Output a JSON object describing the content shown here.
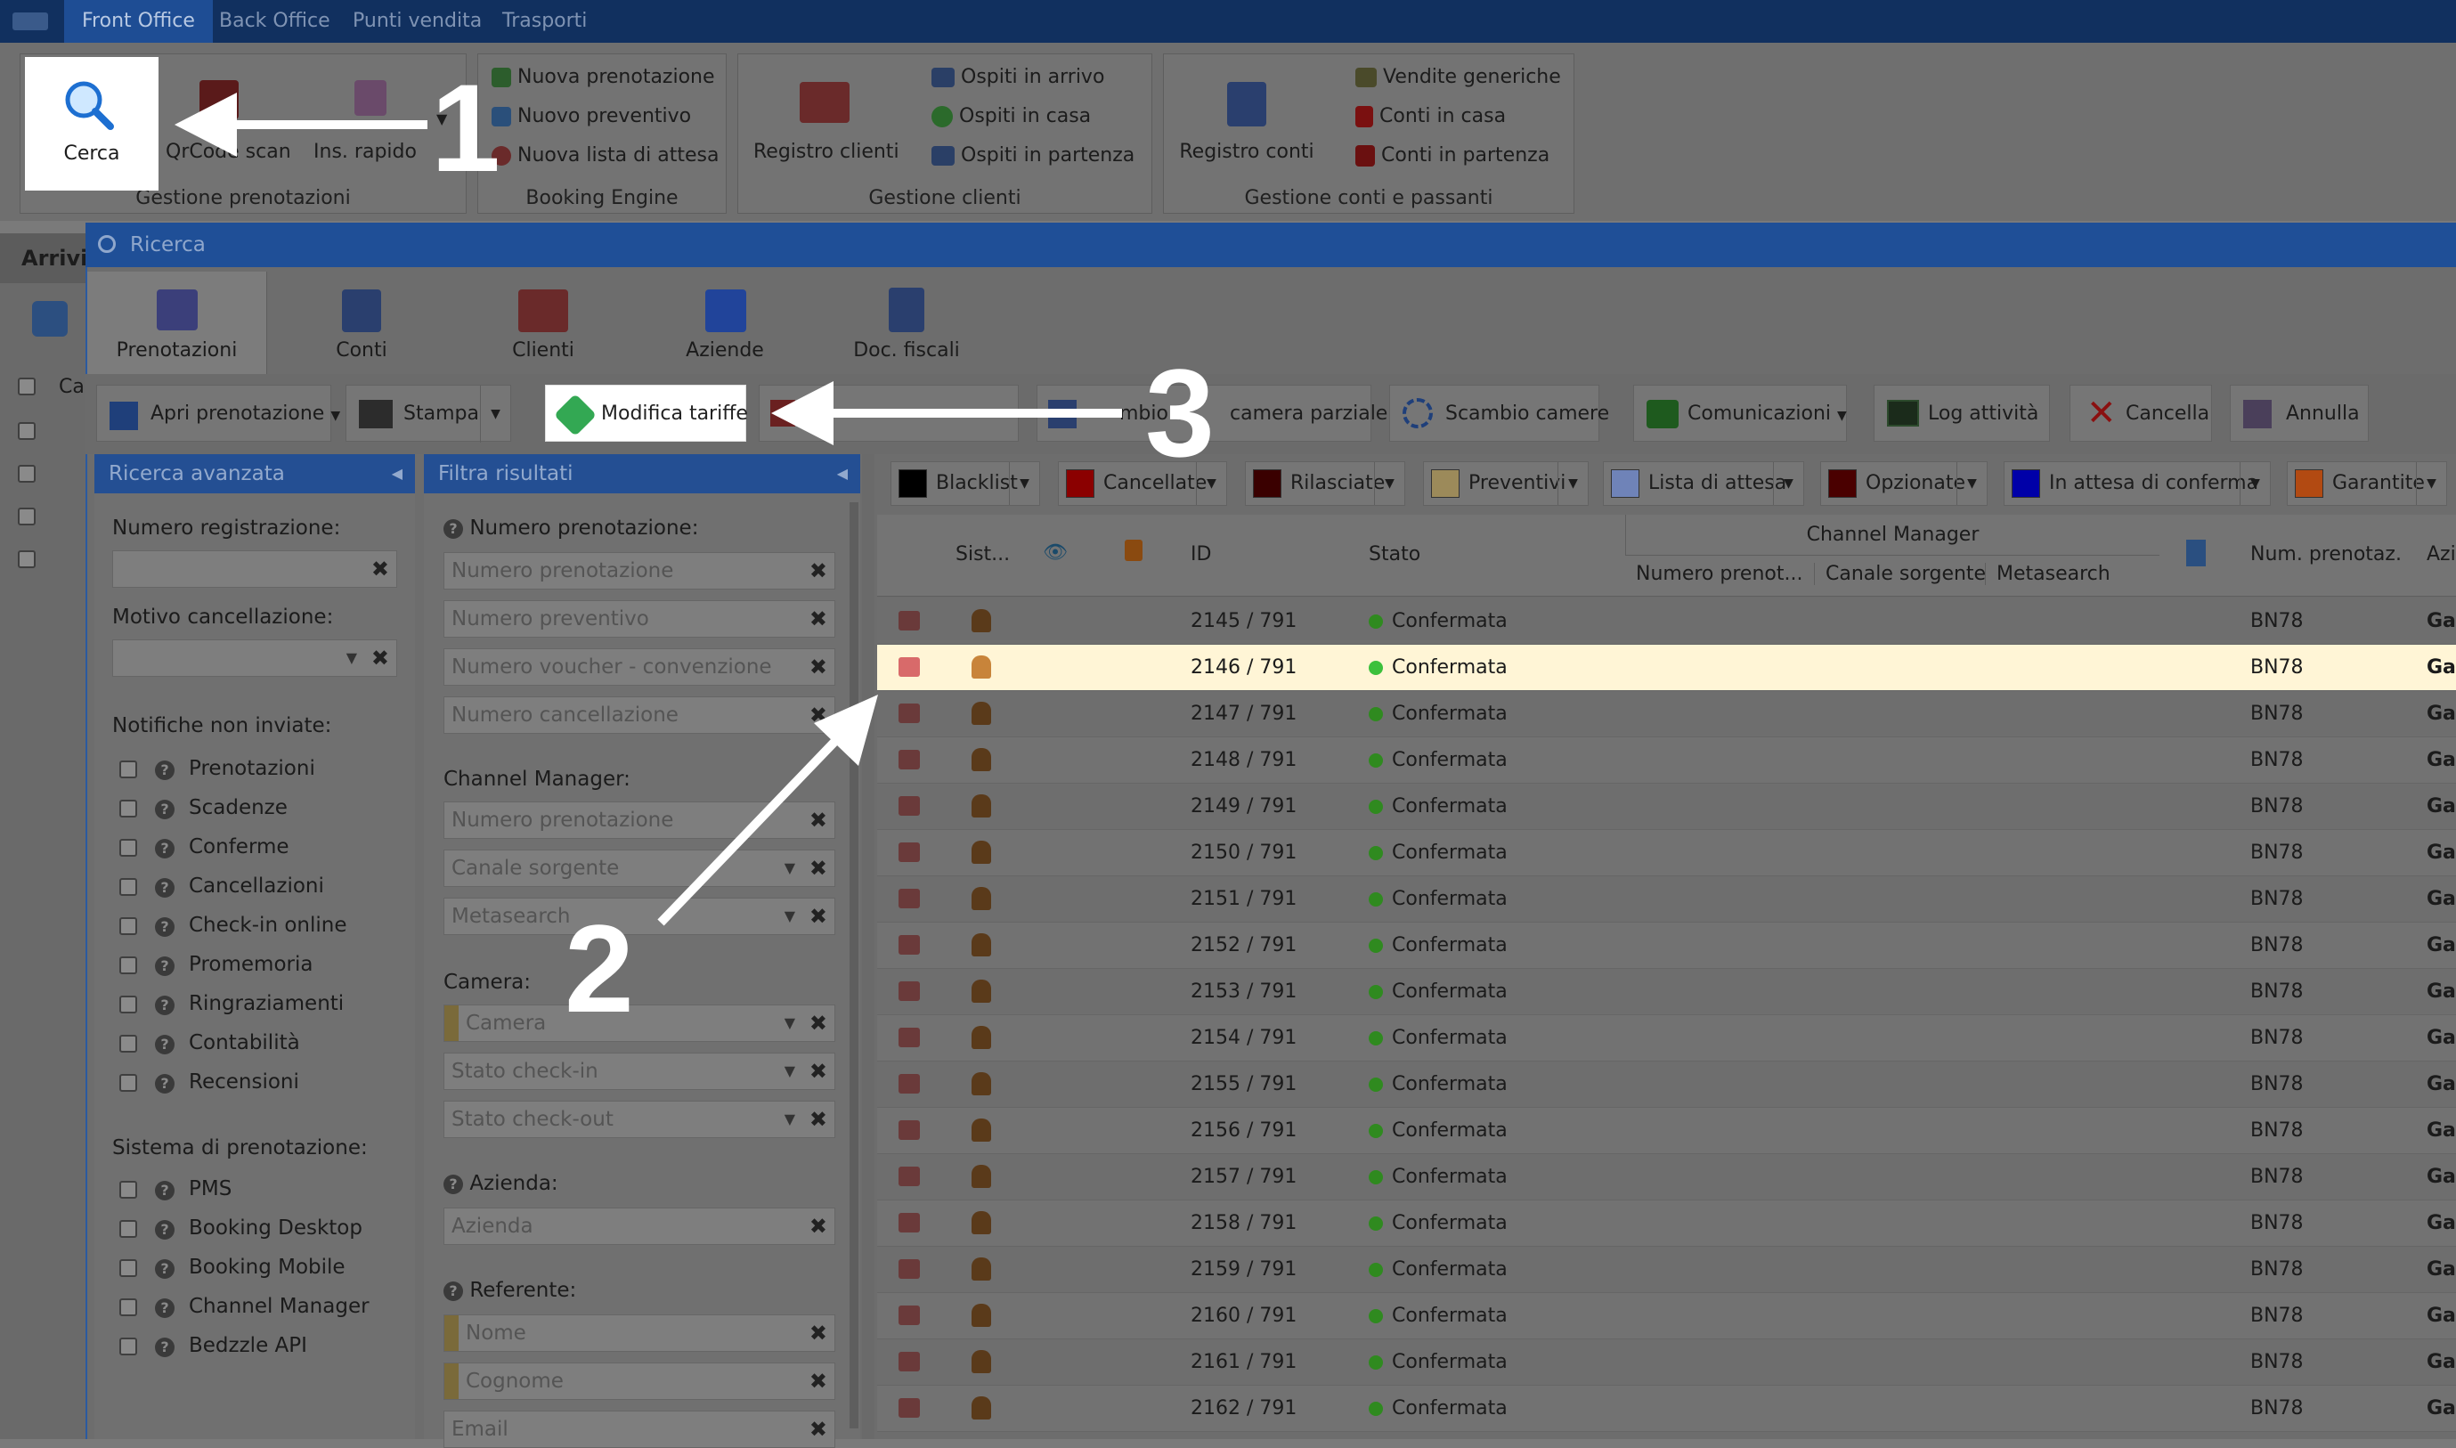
{
  "menu": {
    "tabs": [
      "Front Office",
      "Back Office",
      "Punti vendita",
      "Trasporti"
    ]
  },
  "ribbon": {
    "cerca": "Cerca",
    "qrcode": "QrCode scan",
    "ins_rapido": "Ins. rapido",
    "group1": "Gestione prenotazioni",
    "booking_items": [
      "Nuova prenotazione",
      "Nuovo preventivo",
      "Nuova lista di attesa"
    ],
    "group2": "Booking Engine",
    "registro_clienti": "Registro clienti",
    "clienti_items": [
      "Ospiti in arrivo",
      "Ospiti in casa",
      "Ospiti in partenza"
    ],
    "group3": "Gestione clienti",
    "registro_conti": "Registro conti",
    "conti_items": [
      "Vendite generiche",
      "Conti in casa",
      "Conti in partenza"
    ],
    "group4": "Gestione conti e passanti"
  },
  "left_panel": {
    "title": "Arrivi",
    "col": "Ca"
  },
  "dialog": {
    "title": "Ricerca",
    "tabs": [
      "Prenotazioni",
      "Conti",
      "Clienti",
      "Aziende",
      "Doc. fiscali"
    ]
  },
  "toolbar": {
    "apri": "Apri prenotazione",
    "stampa": "Stampa",
    "modifica": "Modifica tariffe",
    "cambio": "mbio d",
    "camera_parziale": "camera parziale",
    "scambio": "Scambio camere",
    "comunicazioni": "Comunicazioni",
    "log": "Log attività",
    "cancella": "Cancella",
    "annulla": "Annulla"
  },
  "advanced": {
    "title": "Ricerca avanzata",
    "num_reg": "Numero registrazione:",
    "motivo": "Motivo cancellazione:",
    "notifiche": "Notifiche non inviate:",
    "notifiche_items": [
      "Prenotazioni",
      "Scadenze",
      "Conferme",
      "Cancellazioni",
      "Check-in online",
      "Promemoria",
      "Ringraziamenti",
      "Contabilità",
      "Recensioni"
    ],
    "sistema": "Sistema di prenotazione:",
    "sistema_items": [
      "PMS",
      "Booking Desktop",
      "Booking Mobile",
      "Channel Manager",
      "Bedzzle API"
    ]
  },
  "filtra": {
    "title": "Filtra risultati",
    "num_pren": "Numero prenotazione:",
    "fields1": [
      "Numero prenotazione",
      "Numero preventivo",
      "Numero voucher - convenzione",
      "Numero cancellazione"
    ],
    "channel": "Channel Manager:",
    "fields2": [
      "Numero prenotazione",
      "Canale sorgente",
      "Metasearch"
    ],
    "camera": "Camera:",
    "fields3": [
      "Camera",
      "Stato check-in",
      "Stato check-out"
    ],
    "azienda": "Azienda:",
    "azienda_ph": "Azienda",
    "referente": "Referente:",
    "fields4": [
      "Nome",
      "Cognome",
      "Email"
    ]
  },
  "chips": [
    {
      "label": "Blacklist",
      "color": "#000000"
    },
    {
      "label": "Cancellate",
      "color": "#8b0000"
    },
    {
      "label": "Rilasciate",
      "color": "#3a0000"
    },
    {
      "label": "Preventivi",
      "color": "#9c8a5a"
    },
    {
      "label": "Lista di attesa",
      "color": "#6f83b8"
    },
    {
      "label": "Opzionate",
      "color": "#4a0000"
    },
    {
      "label": "In attesa di conferma",
      "color": "#0000a8"
    },
    {
      "label": "Garantite",
      "color": "#b24a12"
    }
  ],
  "table": {
    "headers": {
      "sist": "Sist...",
      "id": "ID",
      "stato": "Stato",
      "cm": "Channel Manager",
      "cm_num": "Numero prenot...",
      "cm_canale": "Canale sorgente",
      "cm_meta": "Metasearch",
      "num_prenotaz": "Num. prenotaz.",
      "az": "Azi"
    },
    "rows": [
      {
        "id": "2145 / 791",
        "stato": "Confermata",
        "num": "BN78",
        "az": "Ga"
      },
      {
        "id": "2146 / 791",
        "stato": "Confermata",
        "num": "BN78",
        "az": "Ga"
      },
      {
        "id": "2147 / 791",
        "stato": "Confermata",
        "num": "BN78",
        "az": "Ga"
      },
      {
        "id": "2148 / 791",
        "stato": "Confermata",
        "num": "BN78",
        "az": "Ga"
      },
      {
        "id": "2149 / 791",
        "stato": "Confermata",
        "num": "BN78",
        "az": "Ga"
      },
      {
        "id": "2150 / 791",
        "stato": "Confermata",
        "num": "BN78",
        "az": "Ga"
      },
      {
        "id": "2151 / 791",
        "stato": "Confermata",
        "num": "BN78",
        "az": "Ga"
      },
      {
        "id": "2152 / 791",
        "stato": "Confermata",
        "num": "BN78",
        "az": "Ga"
      },
      {
        "id": "2153 / 791",
        "stato": "Confermata",
        "num": "BN78",
        "az": "Ga"
      },
      {
        "id": "2154 / 791",
        "stato": "Confermata",
        "num": "BN78",
        "az": "Ga"
      },
      {
        "id": "2155 / 791",
        "stato": "Confermata",
        "num": "BN78",
        "az": "Ga"
      },
      {
        "id": "2156 / 791",
        "stato": "Confermata",
        "num": "BN78",
        "az": "Ga"
      },
      {
        "id": "2157 / 791",
        "stato": "Confermata",
        "num": "BN78",
        "az": "Ga"
      },
      {
        "id": "2158 / 791",
        "stato": "Confermata",
        "num": "BN78",
        "az": "Ga"
      },
      {
        "id": "2159 / 791",
        "stato": "Confermata",
        "num": "BN78",
        "az": "Ga"
      },
      {
        "id": "2160 / 791",
        "stato": "Confermata",
        "num": "BN78",
        "az": "Ga"
      },
      {
        "id": "2161 / 791",
        "stato": "Confermata",
        "num": "BN78",
        "az": "Ga"
      },
      {
        "id": "2162 / 791",
        "stato": "Confermata",
        "num": "BN78",
        "az": "Ga"
      }
    ]
  },
  "annotations": {
    "n1": "1",
    "n2": "2",
    "n3": "3"
  }
}
